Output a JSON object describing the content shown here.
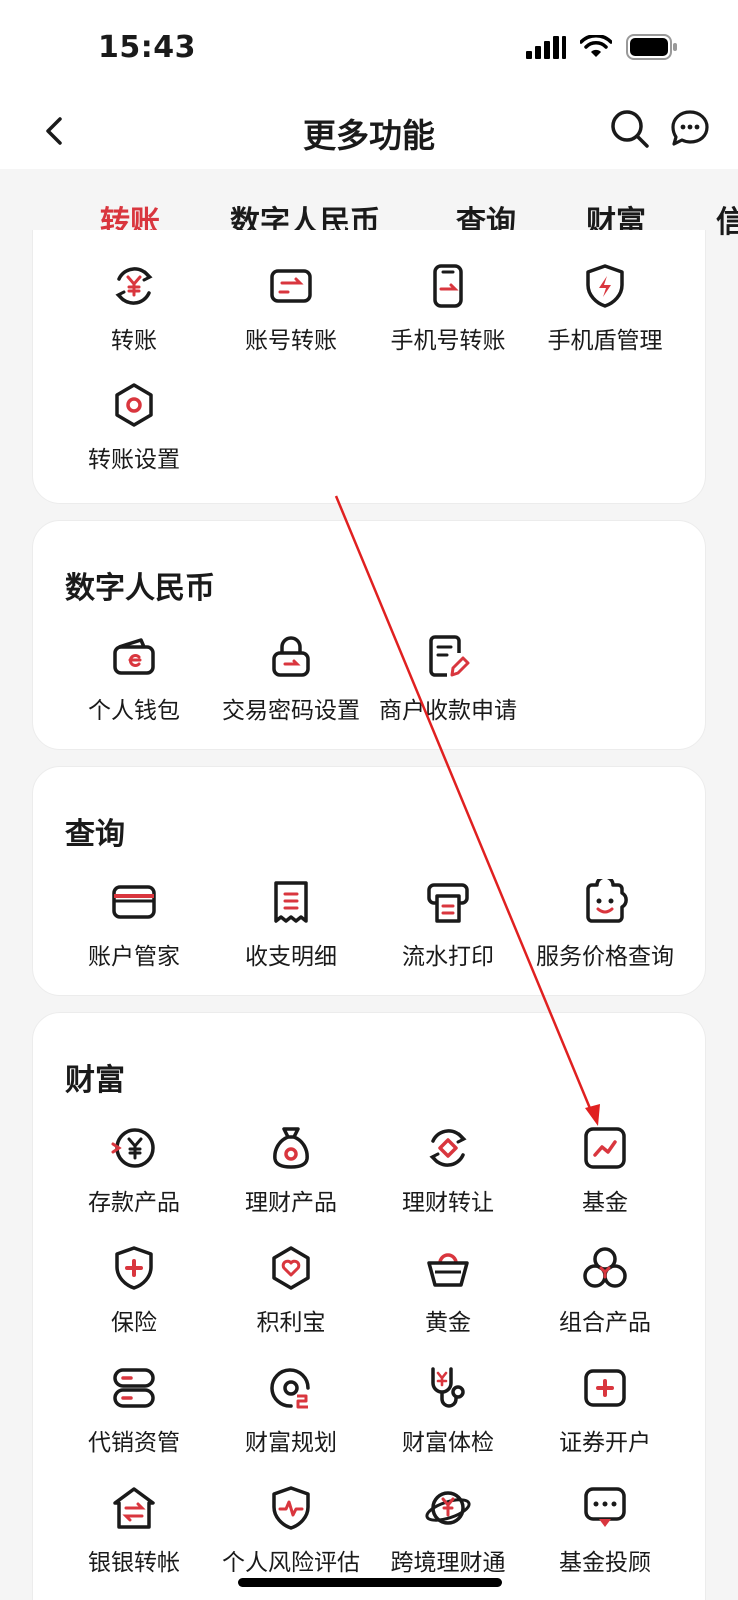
{
  "status": {
    "time": "15:43"
  },
  "header": {
    "title": "更多功能"
  },
  "tabs": [
    "转账",
    "数字人民币",
    "查询",
    "财富",
    "信"
  ],
  "sections": {
    "transfer": {
      "items": [
        "转账",
        "账号转账",
        "手机号转账",
        "手机盾管理",
        "转账设置"
      ]
    },
    "ecny": {
      "title": "数字人民币",
      "items": [
        "个人钱包",
        "交易密码设置",
        "商户收款申请"
      ]
    },
    "query": {
      "title": "查询",
      "items": [
        "账户管家",
        "收支明细",
        "流水打印",
        "服务价格查询"
      ]
    },
    "wealth": {
      "title": "财富",
      "items": [
        "存款产品",
        "理财产品",
        "理财转让",
        "基金",
        "保险",
        "积利宝",
        "黄金",
        "组合产品",
        "代销资管",
        "财富规划",
        "财富体检",
        "证券开户",
        "银银转帐",
        "个人风险评估",
        "跨境理财通",
        "基金投顾"
      ]
    }
  },
  "colors": {
    "accent": "#d9363e",
    "text": "#1a1a1a",
    "background": "#f5f5f5"
  }
}
